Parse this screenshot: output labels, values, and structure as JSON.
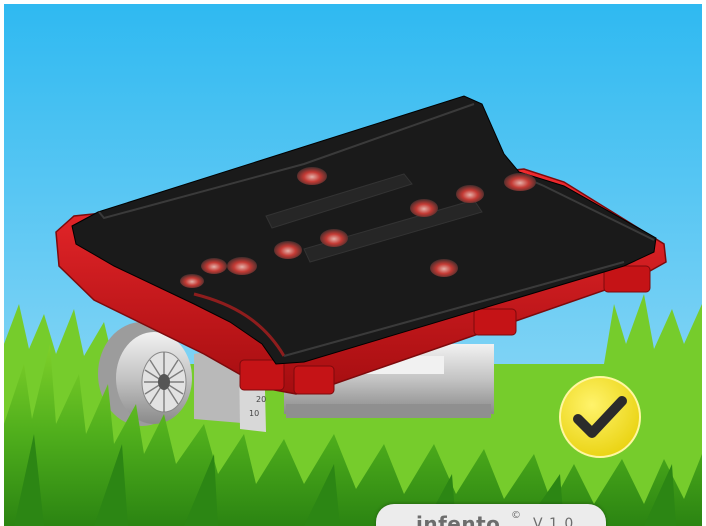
{
  "scene": {
    "colors": {
      "sky_top": "#34bdf2",
      "sky_bottom": "#9ee0f7",
      "grass_dark": "#2e8f16",
      "grass_light": "#8fdc2c",
      "plate": "#1b1b1b",
      "frame_red": "#d5171b",
      "wheel": "#c9c9c9",
      "badge_yellow": "#f6e52a"
    }
  },
  "badge": {
    "icon": "checkmark-icon"
  },
  "brand": {
    "name": "infento",
    "mark": "©",
    "version": "V 1.0"
  }
}
